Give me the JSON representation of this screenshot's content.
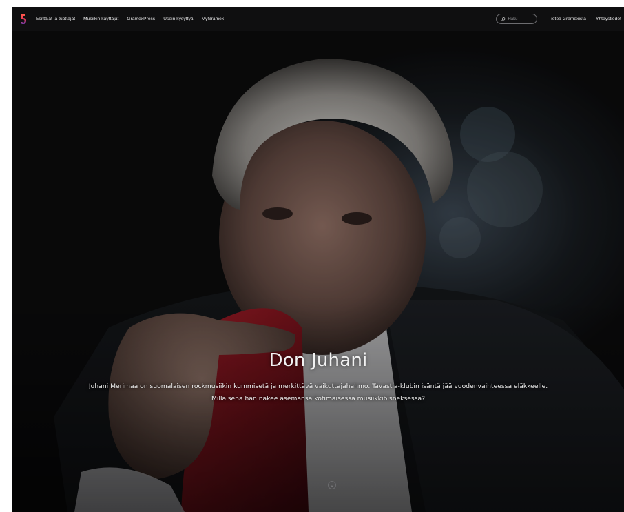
{
  "nav": {
    "items": [
      {
        "label": "Esittäjät ja tuottajat"
      },
      {
        "label": "Musiikin käyttäjät"
      },
      {
        "label": "GramexPress"
      },
      {
        "label": "Usein kysyttyä"
      },
      {
        "label": "MyGramex"
      }
    ],
    "search": {
      "placeholder": "Haku",
      "value": ""
    },
    "right_items": [
      {
        "label": "Tietoa Gramexista"
      },
      {
        "label": "Yhteystiedot"
      }
    ]
  },
  "hero": {
    "title": "Don Juhani",
    "lead_line1": "Juhani Merimaa on suomalaisen rockmusiikin kummisetä ja merkittävä vaikuttajahahmo. Tavastia-klubin isäntä jää vuodenvaihteessa eläkkeelle.",
    "lead_line2": "Millaisena hän näkee asemansa kotimaisessa musiikkibisneksessä?"
  },
  "colors": {
    "brand_logo_top": "#e8375a",
    "brand_logo_bottom": "#7c3fb3",
    "nav_bg": "#0f0f10",
    "scarf_red": "#8b1620"
  },
  "icons": {
    "logo": "gramex-logo",
    "search": "search-icon",
    "scroll": "chevron-down-icon"
  }
}
